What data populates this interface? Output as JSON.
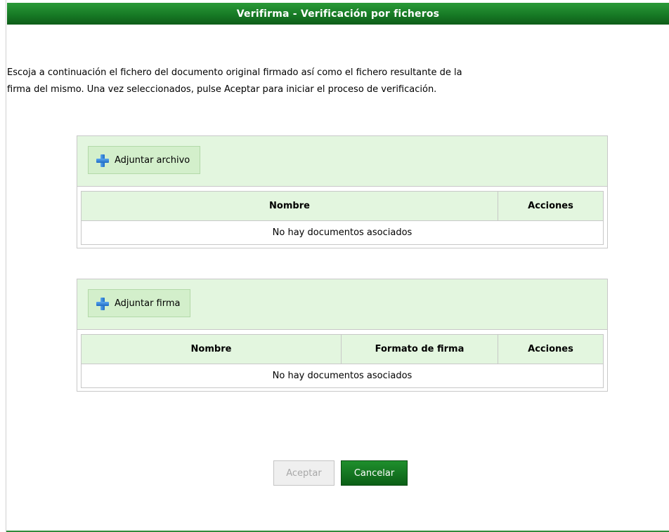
{
  "window": {
    "title": "Verifirma - Verificación por ficheros"
  },
  "intro": {
    "line1": "Escoja a continuación el fichero del documento original firmado así como el fichero resultante de la",
    "line2": "firma del mismo. Una vez seleccionados, pulse Aceptar para iniciar el proceso de verificación."
  },
  "archivo_panel": {
    "button_label": "Adjuntar archivo",
    "button_icon": "plus-icon",
    "columns": [
      "Nombre",
      "Acciones"
    ],
    "empty_text": "No hay documentos asociados"
  },
  "firma_panel": {
    "button_label": "Adjuntar firma",
    "button_icon": "plus-icon",
    "columns": [
      "Nombre",
      "Formato de firma",
      "Acciones"
    ],
    "empty_text": "No hay documentos asociados"
  },
  "actions": {
    "accept_label": "Aceptar",
    "accept_enabled": false,
    "cancel_label": "Cancelar"
  },
  "colors": {
    "title_green": "#177a25",
    "panel_green": "#e3f6df",
    "cancel_green": "#0b5f16"
  }
}
